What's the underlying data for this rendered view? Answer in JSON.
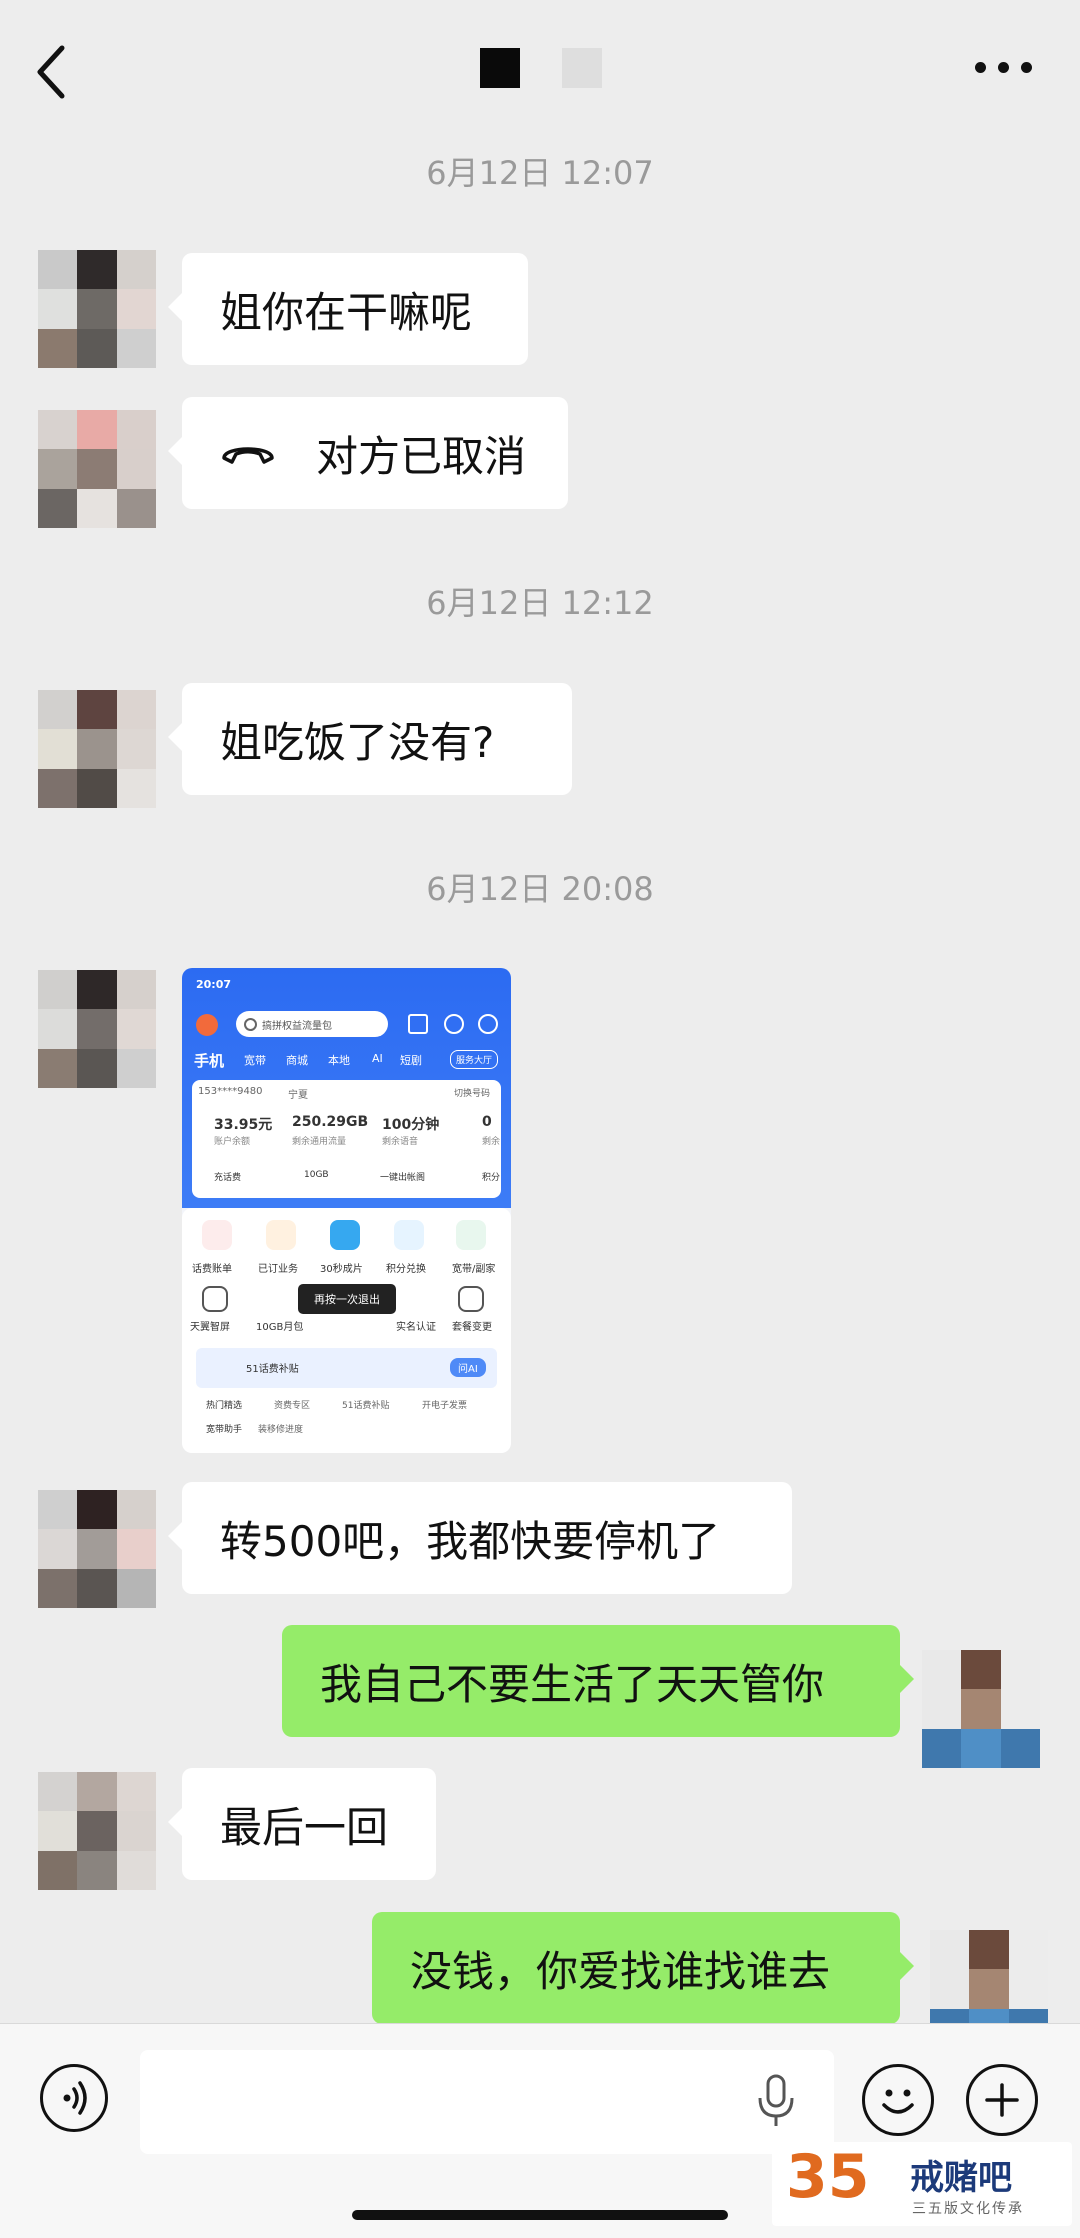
{
  "header": {
    "back_icon": "chevron-left-icon",
    "more_icon": "more-dots-icon"
  },
  "timestamps": [
    "6月12日 12:07",
    "6月12日 12:12",
    "6月12日 20:08"
  ],
  "messages": [
    {
      "side": "left",
      "text": "姐你在干嘛呢"
    },
    {
      "side": "left",
      "type": "call",
      "icon": "phone-hangup-icon",
      "text": "对方已取消"
    },
    {
      "side": "left",
      "text": "姐吃饭了没有?"
    },
    {
      "side": "left",
      "type": "image"
    },
    {
      "side": "left",
      "text": "转500吧，我都快要停机了"
    },
    {
      "side": "right",
      "text": "我自己不要生活了天天管你"
    },
    {
      "side": "left",
      "text": "最后一回"
    },
    {
      "side": "right",
      "text": "没钱，你爱找谁找谁去"
    }
  ],
  "screenshot": {
    "status_time": "20:07",
    "search_placeholder": "搞拼权益流量包",
    "tabs": [
      "手机",
      "宽带",
      "商城",
      "本地",
      "AI",
      "短剧"
    ],
    "service_hall": "服务大厅",
    "phone_number": "153****9480",
    "region": "宁夏",
    "switch_number": "切换号码",
    "stats": [
      {
        "value": "33.95元",
        "label": "账户余额",
        "action": "充话费"
      },
      {
        "value": "250.29GB",
        "label": "剩余通用流量",
        "action": "10GB"
      },
      {
        "value": "100分钟",
        "label": "剩余语音",
        "action": "一键出帐阁"
      },
      {
        "value": "0",
        "label": "剩余",
        "action": "积分"
      }
    ],
    "grid_row1": [
      "话费账单",
      "已订业务",
      "30秒成片",
      "积分兑换",
      "宽带/副家"
    ],
    "grid_row2": [
      "天翼智屏",
      "10GB月包",
      "",
      "实名认证",
      "套餐变更"
    ],
    "toast": "再按一次退出",
    "banner_text": "51话费补贴",
    "banner_button": "问AI",
    "hot_label": "热门精选",
    "hot_items": [
      "资费专区",
      "51话费补贴",
      "开电子发票"
    ],
    "broadband_label": "宽带助手",
    "broadband_item": "装移修进度"
  },
  "inputbar": {
    "voice_icon": "voice-icon",
    "mic_icon": "microphone-icon",
    "emoji_icon": "emoji-icon",
    "plus_icon": "plus-icon"
  },
  "watermark": {
    "number": "35",
    "name": "戒赌吧",
    "subtitle": "三五版文化传承"
  }
}
